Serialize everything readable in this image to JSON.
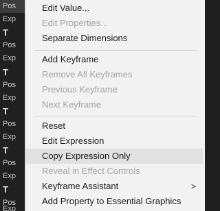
{
  "left_panel": {
    "rows": [
      {
        "kind": "pos",
        "text": "Pos",
        "selected": true
      },
      {
        "kind": "exp",
        "text": "Exp"
      },
      {
        "kind": "t",
        "text": "T"
      },
      {
        "kind": "pos",
        "text": "Pos"
      },
      {
        "kind": "exp",
        "text": "Exp"
      },
      {
        "kind": "t",
        "text": "T"
      },
      {
        "kind": "pos",
        "text": "Pos"
      },
      {
        "kind": "exp",
        "text": "Exp"
      },
      {
        "kind": "t",
        "text": "T"
      },
      {
        "kind": "pos",
        "text": "Pos"
      },
      {
        "kind": "exp",
        "text": "Exp"
      },
      {
        "kind": "t",
        "text": "T"
      },
      {
        "kind": "pos",
        "text": "Pos"
      },
      {
        "kind": "exp",
        "text": "Exp"
      },
      {
        "kind": "t",
        "text": "T"
      },
      {
        "kind": "pos",
        "text": "Pos"
      },
      {
        "kind": "exp",
        "text": "Exp"
      }
    ]
  },
  "context_menu": {
    "items": [
      {
        "label": "Edit Value...",
        "enabled": true
      },
      {
        "label": "Edit Properties...",
        "enabled": false
      },
      {
        "label": "Separate Dimensions",
        "enabled": true
      },
      {
        "separator": true
      },
      {
        "label": "Add Keyframe",
        "enabled": true
      },
      {
        "label": "Remove All Keyframes",
        "enabled": false
      },
      {
        "label": "Previous Keyframe",
        "enabled": false
      },
      {
        "label": "Next Keyframe",
        "enabled": false
      },
      {
        "separator": true
      },
      {
        "label": "Reset",
        "enabled": true
      },
      {
        "label": "Edit Expression",
        "enabled": true
      },
      {
        "label": "Copy Expression Only",
        "enabled": true,
        "highlighted": true
      },
      {
        "label": "Reveal in Effect Controls",
        "enabled": false
      },
      {
        "label": "Keyframe Assistant",
        "enabled": true,
        "submenu": true,
        "submenu_glyph": ">"
      },
      {
        "label": "Add Property to Essential Graphics",
        "enabled": true
      }
    ]
  }
}
